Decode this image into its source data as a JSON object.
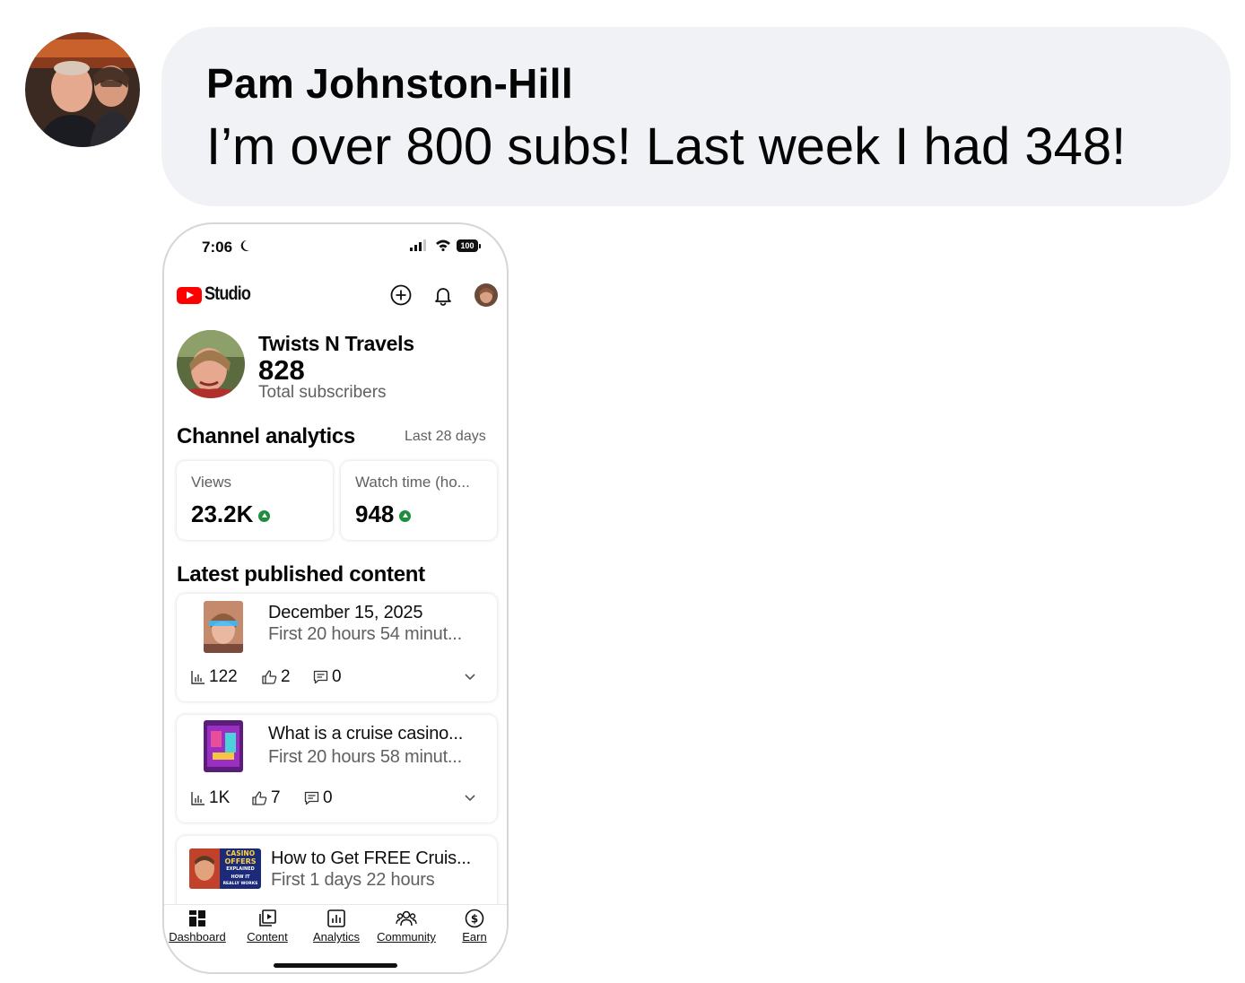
{
  "comment": {
    "author": "Pam Johnston-Hill",
    "text": "I’m over 800 subs! Last week I had 348!"
  },
  "phone": {
    "status_bar": {
      "time": "7:06",
      "battery": "100"
    },
    "app": {
      "name": "Studio"
    },
    "channel": {
      "name": "Twists N Travels",
      "subscribers": "828",
      "subscribers_label": "Total subscribers"
    },
    "analytics": {
      "title": "Channel analytics",
      "range": "Last 28 days",
      "metrics": [
        {
          "label": "Views",
          "value": "23.2K",
          "trend": "up"
        },
        {
          "label": "Watch time (ho...",
          "value": "948",
          "trend": "up"
        }
      ]
    },
    "latest": {
      "title": "Latest published content",
      "videos": [
        {
          "title": "December 15, 2025",
          "subtitle": "First 20 hours 54 minut...",
          "views": "122",
          "likes": "2",
          "comments": "0"
        },
        {
          "title": "What is a cruise casino...",
          "subtitle": "First 20 hours 58 minut...",
          "views": "1K",
          "likes": "7",
          "comments": "0"
        },
        {
          "title": "How to Get FREE Cruis...",
          "subtitle": "First 1 days 22 hours",
          "thumb_text": [
            "CASINO",
            "OFFERS",
            "EXPLAINED",
            "HOW IT",
            "REALLY WORKS"
          ]
        }
      ]
    },
    "nav": [
      {
        "label": "Dashboard",
        "icon": "dashboard-icon"
      },
      {
        "label": "Content",
        "icon": "content-icon"
      },
      {
        "label": "Analytics",
        "icon": "analytics-icon"
      },
      {
        "label": "Community",
        "icon": "community-icon"
      },
      {
        "label": "Earn",
        "icon": "earn-icon"
      }
    ],
    "colors": {
      "youtube_red": "#ff0000",
      "trend_green": "#1e8e3e",
      "bubble": "#f0f2f5"
    }
  }
}
